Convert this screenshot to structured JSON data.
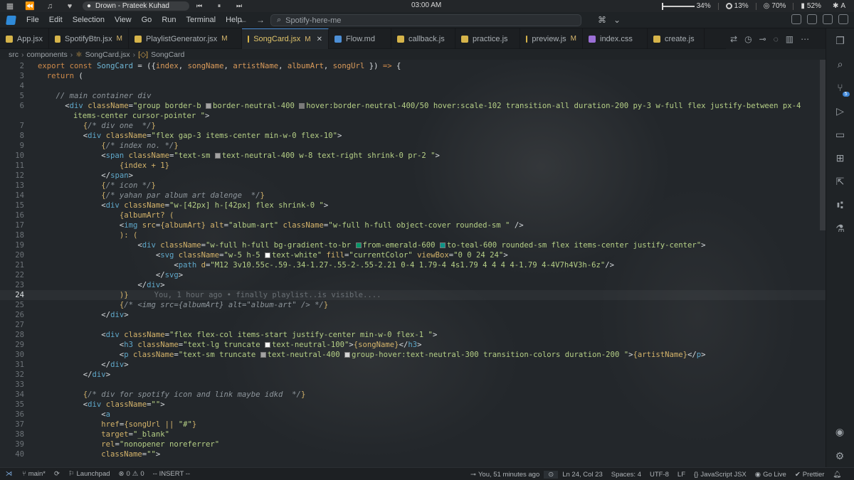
{
  "system": {
    "now_playing": "Drown - Prateek Kuhad",
    "clock": "03:00 AM",
    "volume": "34%",
    "brightness": "13%",
    "network": "70%",
    "battery": "52%",
    "keyboard": "A",
    "left_icons": [
      "app-grid-icon",
      "rewind-icon",
      "music-icon",
      "heart-icon"
    ],
    "media_controls": [
      "previous-icon",
      "pause-icon",
      "next-icon"
    ]
  },
  "menu": [
    "File",
    "Edit",
    "Selection",
    "View",
    "Go",
    "Run",
    "Terminal",
    "Help"
  ],
  "search": {
    "placeholder": "Spotify-here-me"
  },
  "tabs": [
    {
      "label": "App.jsx",
      "mod": "",
      "color": "#d6b44a"
    },
    {
      "label": "SpotifyBtn.jsx",
      "mod": "M",
      "color": "#d6b44a"
    },
    {
      "label": "PlaylistGenerator.jsx",
      "mod": "M",
      "color": "#d6b44a"
    },
    {
      "label": "SongCard.jsx",
      "mod": "M",
      "color": "#d6b44a"
    },
    {
      "label": "Flow.md",
      "mod": "",
      "color": "#4d8fd6"
    },
    {
      "label": "callback.js",
      "mod": "",
      "color": "#d6b44a"
    },
    {
      "label": "practice.js",
      "mod": "",
      "color": "#d6b44a"
    },
    {
      "label": "preview.js",
      "mod": "M",
      "color": "#d6b44a"
    },
    {
      "label": "index.css",
      "mod": "",
      "color": "#9b6fd6"
    },
    {
      "label": "create.js",
      "mod": "",
      "color": "#d6b44a"
    }
  ],
  "breadcrumb": [
    "src",
    "components",
    "SongCard.jsx",
    "SongCard"
  ],
  "editor": {
    "current_line": 24,
    "blame": "You, 1 hour ago • finally playlist..is visible...."
  },
  "status": {
    "branch": "main*",
    "launchpad": "Launchpad",
    "errors": "0",
    "warnings": "0",
    "mode": "-- INSERT --",
    "blame": "You, 51 minutes ago",
    "position": "Ln 24, Col 23",
    "spaces": "Spaces: 4",
    "encoding": "UTF-8",
    "eol": "LF",
    "language": "JavaScript JSX",
    "golive": "Go Live",
    "prettier": "Prettier"
  },
  "activity": {
    "items": [
      "explorer-icon",
      "search-icon",
      "source-control-icon",
      "run-debug-icon",
      "remote-explorer-icon",
      "extensions-icon",
      "live-share-icon",
      "git-graph-icon",
      "testing-icon"
    ],
    "scm_badge": "5"
  }
}
